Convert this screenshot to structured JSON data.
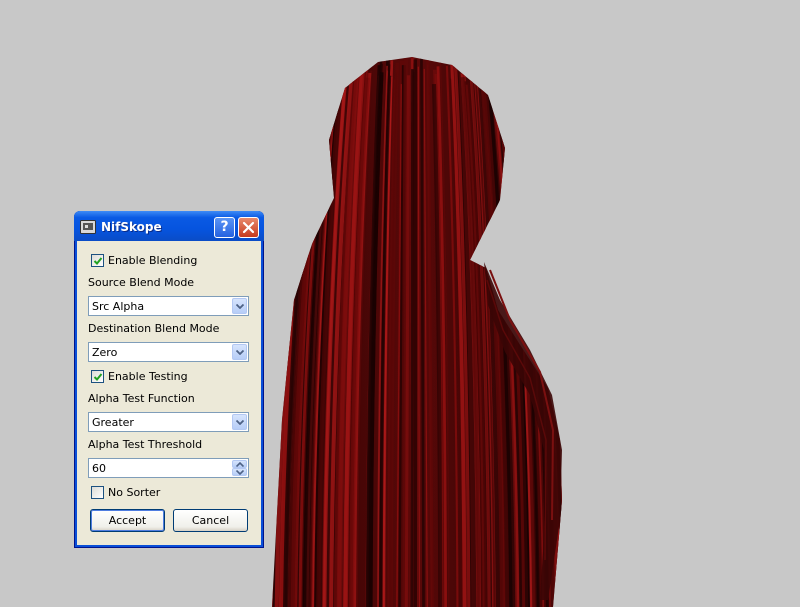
{
  "dialog": {
    "title": "NifSkope",
    "help_glyph": "?",
    "enable_blending_label": "Enable Blending",
    "enable_blending_checked": true,
    "source_blend_label": "Source Blend Mode",
    "source_blend_value": "Src Alpha",
    "dest_blend_label": "Destination Blend Mode",
    "dest_blend_value": "Zero",
    "enable_testing_label": "Enable Testing",
    "enable_testing_checked": true,
    "alpha_func_label": "Alpha Test Function",
    "alpha_func_value": "Greater",
    "alpha_threshold_label": "Alpha Test Threshold",
    "alpha_threshold_value": "60",
    "no_sorter_label": "No Sorter",
    "no_sorter_checked": false,
    "accept_label": "Accept",
    "cancel_label": "Cancel"
  },
  "colors": {
    "background": "#c8c8c8",
    "hair_dark": "#1a0202",
    "hair_red": "#8a0d0d",
    "titlebar_blue": "#0654df"
  },
  "icons": {
    "app": "nifskope-app-icon",
    "help": "help-icon",
    "close": "close-icon",
    "dropdown": "chevron-down-icon",
    "spin_up": "spin-up-icon",
    "spin_down": "spin-down-icon",
    "check": "checkmark-icon"
  }
}
